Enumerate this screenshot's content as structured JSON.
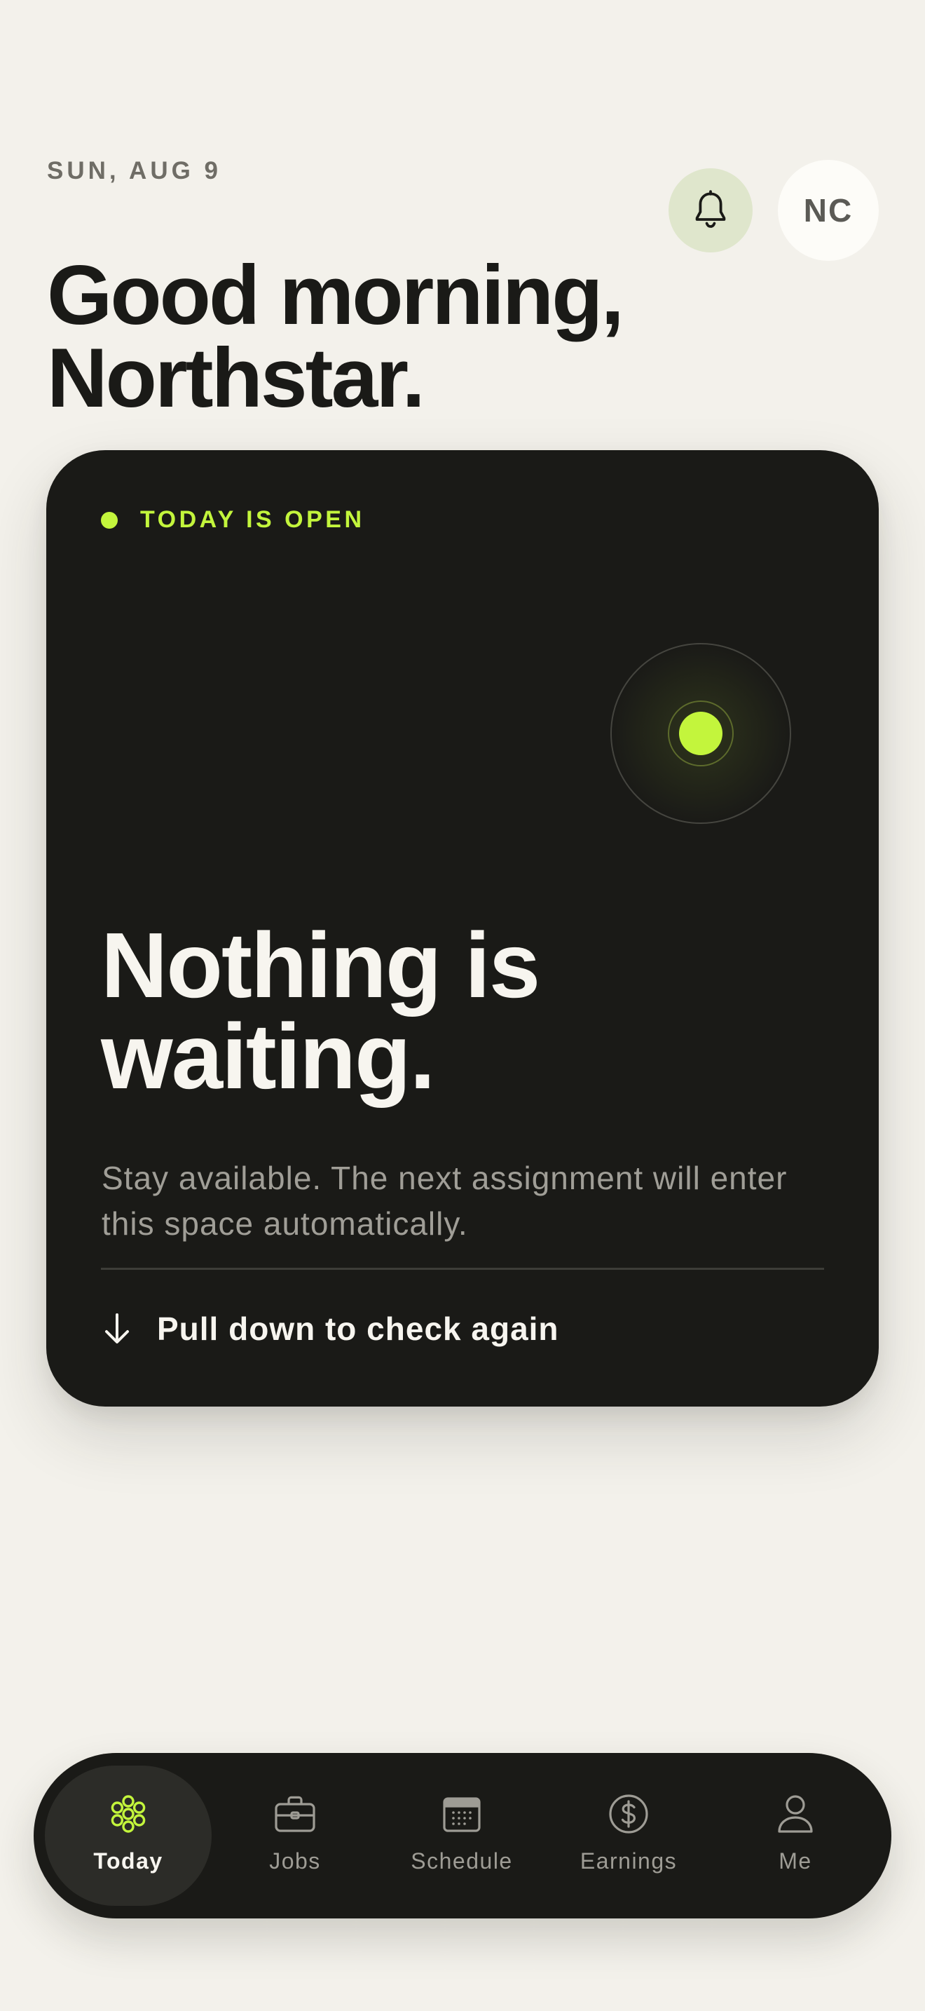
{
  "header": {
    "date": "SUN, AUG 9",
    "greeting_line1": "Good morning,",
    "greeting_line2": "Northstar.",
    "avatar_initials": "NC",
    "notifications_icon": "bell-icon"
  },
  "status_card": {
    "status_label": "TODAY IS OPEN",
    "headline_line1": "Nothing is",
    "headline_line2": "waiting.",
    "description": "Stay available. The next assignment will enter this space automatically.",
    "refresh_hint": "Pull down to check again",
    "refresh_icon": "arrow-down-icon",
    "accent_color": "#c3f53c",
    "background_color": "#1a1a17"
  },
  "tab_bar": {
    "active_tab": "Today",
    "tabs": [
      {
        "label": "Today",
        "icon": "flower-icon"
      },
      {
        "label": "Jobs",
        "icon": "briefcase-icon"
      },
      {
        "label": "Schedule",
        "icon": "calendar-icon"
      },
      {
        "label": "Earnings",
        "icon": "dollar-icon"
      },
      {
        "label": "Me",
        "icon": "person-icon"
      }
    ]
  },
  "colors": {
    "page_background": "#f3f1eb",
    "accent": "#c3f53c",
    "dark_surface": "#1a1a17",
    "bell_background": "#dfe6cc"
  }
}
